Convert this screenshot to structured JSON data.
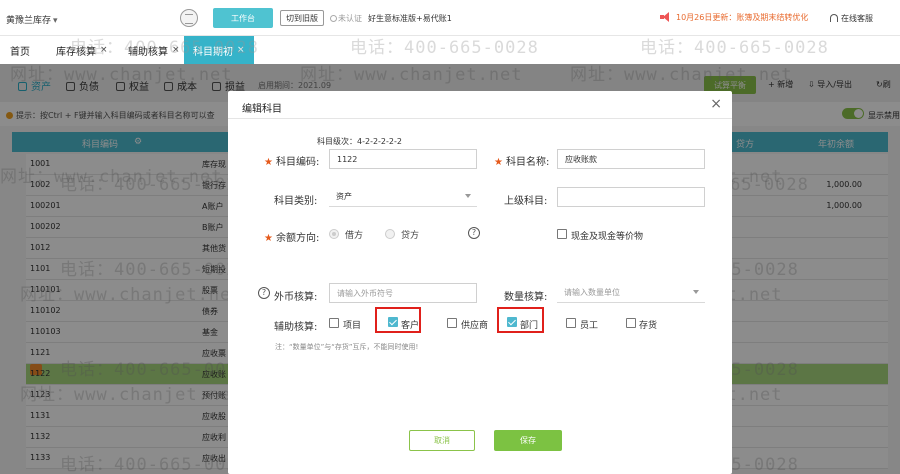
{
  "topbar": {
    "company": "黄豫兰库存",
    "workbench": "工作台",
    "old_version": "切到旧版",
    "cert": "未认证",
    "edition": "好生意标准版+易代账1",
    "notice": "10月26日更新：账簿及期末结转优化",
    "service": "在线客服"
  },
  "tabs": [
    {
      "label": "首页"
    },
    {
      "label": "库存核算",
      "close": "×"
    },
    {
      "label": "辅助核算",
      "close": "×"
    },
    {
      "label": "科目期初",
      "close": "×"
    }
  ],
  "subtabs": [
    "资产",
    "负债",
    "权益",
    "成本",
    "损益"
  ],
  "period": "启用期间：2021.09",
  "toolbar": {
    "trial": "试算平衡",
    "add": "+ 新增",
    "import_export": "导入/导出",
    "refresh": "刷"
  },
  "tip": "提示：按Ctrl + F键并输入科目编码或者科目名称可以查",
  "show_disabled": "显示禁用",
  "table": {
    "headers": {
      "code": "科目编码",
      "dir": "贷方",
      "balance": "年初余额"
    },
    "rows": [
      {
        "code": "1001",
        "name": "库存现",
        "amount": ""
      },
      {
        "code": "1002",
        "name": "银行存",
        "amount": "1,000.00"
      },
      {
        "code": "100201",
        "name": "A账户",
        "amount": "1,000.00"
      },
      {
        "code": "100202",
        "name": "B账户",
        "amount": ""
      },
      {
        "code": "1012",
        "name": "其他货",
        "amount": ""
      },
      {
        "code": "1101",
        "name": "短期投",
        "amount": ""
      },
      {
        "code": "110101",
        "name": "股票",
        "amount": ""
      },
      {
        "code": "110102",
        "name": "债券",
        "amount": ""
      },
      {
        "code": "110103",
        "name": "基金",
        "amount": ""
      },
      {
        "code": "1121",
        "name": "应收票",
        "amount": ""
      },
      {
        "code": "1122",
        "name": "应收账",
        "amount": ""
      },
      {
        "code": "1123",
        "name": "预付账",
        "amount": ""
      },
      {
        "code": "1131",
        "name": "应收股",
        "amount": ""
      },
      {
        "code": "1132",
        "name": "应收利",
        "amount": ""
      },
      {
        "code": "1133",
        "name": "应收出",
        "amount": ""
      }
    ]
  },
  "modal": {
    "title": "编辑科目",
    "close": "×",
    "level_hint": "科目级次：4-2-2-2-2-2",
    "code_label": "科目编码:",
    "code_value": "1122",
    "name_label": "科目名称:",
    "name_value": "应收账款",
    "category_label": "科目类别:",
    "category_value": "资产",
    "parent_label": "上级科目:",
    "parent_value": "",
    "balance_dir_label": "余额方向:",
    "debit": "借方",
    "credit": "贷方",
    "cash_equiv": "现金及现金等价物",
    "forex_label": "外币核算:",
    "forex_placeholder": "请输入外币符号",
    "qty_label": "数量核算:",
    "qty_placeholder": "请输入数量单位",
    "aux_label": "辅助核算:",
    "aux_items": [
      {
        "label": "项目",
        "checked": false
      },
      {
        "label": "客户",
        "checked": true
      },
      {
        "label": "供应商",
        "checked": false
      },
      {
        "label": "部门",
        "checked": true
      },
      {
        "label": "员工",
        "checked": false
      },
      {
        "label": "存货",
        "checked": false
      }
    ],
    "note": "注：“数量单位”与“存货”互斥，不能同时使用!",
    "cancel": "取消",
    "save": "保存"
  },
  "watermark": {
    "phone": "电话：400-665-0028",
    "site": "网址：www.chanjet.net"
  },
  "colors": {
    "accent": "#36b3c9",
    "green": "#7cc242",
    "highlight": "#e0201b",
    "notice": "#e86a2e"
  }
}
